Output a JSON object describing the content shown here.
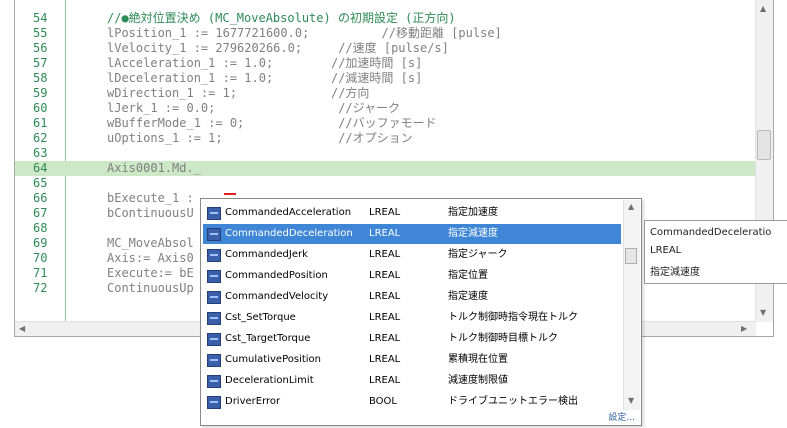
{
  "editor": {
    "lines": [
      {
        "num": "54",
        "code": "//●絶対位置決め (MC_MoveAbsolute) の初期設定 (正方向)",
        "kind": "comment"
      },
      {
        "num": "55",
        "code": "lPosition_1 := 1677721600.0;          //移動距離 [pulse]",
        "kind": "code"
      },
      {
        "num": "56",
        "code": "lVelocity_1 := 279620266.0;     //速度 [pulse/s]",
        "kind": "code"
      },
      {
        "num": "57",
        "code": "lAcceleration_1 := 1.0;        //加速時間 [s]",
        "kind": "code"
      },
      {
        "num": "58",
        "code": "lDeceleration_1 := 1.0;        //減速時間 [s]",
        "kind": "code"
      },
      {
        "num": "59",
        "code": "wDirection_1 := 1;             //方向",
        "kind": "code"
      },
      {
        "num": "60",
        "code": "lJerk_1 := 0.0;                 //ジャーク",
        "kind": "code"
      },
      {
        "num": "61",
        "code": "wBufferMode_1 := 0;             //バッファモード",
        "kind": "code"
      },
      {
        "num": "62",
        "code": "uOptions_1 := 1;                //オプション",
        "kind": "code"
      },
      {
        "num": "63",
        "code": "",
        "kind": "code"
      },
      {
        "num": "64",
        "code": "Axis0001.Md._",
        "kind": "code",
        "highlight": true
      },
      {
        "num": "65",
        "code": "",
        "kind": "code"
      },
      {
        "num": "66",
        "code": "bExecute_1 :",
        "kind": "code"
      },
      {
        "num": "67",
        "code": "bContinuousU",
        "kind": "code"
      },
      {
        "num": "68",
        "code": "",
        "kind": "code"
      },
      {
        "num": "69",
        "code": "MC_MoveAbsol",
        "kind": "code"
      },
      {
        "num": "70",
        "code": "Axis:= Axis0",
        "kind": "code"
      },
      {
        "num": "71",
        "code": "Execute:= bE",
        "kind": "code"
      },
      {
        "num": "72",
        "code": "ContinuousUp",
        "kind": "code"
      }
    ]
  },
  "completion": {
    "items": [
      {
        "name": "CommandedAcceleration",
        "type": "LREAL",
        "desc": "指定加速度",
        "selected": false
      },
      {
        "name": "CommandedDeceleration",
        "type": "LREAL",
        "desc": "指定減速度",
        "selected": true
      },
      {
        "name": "CommandedJerk",
        "type": "LREAL",
        "desc": "指定ジャーク",
        "selected": false
      },
      {
        "name": "CommandedPosition",
        "type": "LREAL",
        "desc": "指定位置",
        "selected": false
      },
      {
        "name": "CommandedVelocity",
        "type": "LREAL",
        "desc": "指定速度",
        "selected": false
      },
      {
        "name": "Cst_SetTorque",
        "type": "LREAL",
        "desc": "トルク制御時指令現在トルク",
        "selected": false
      },
      {
        "name": "Cst_TargetTorque",
        "type": "LREAL",
        "desc": "トルク制御時目標トルク",
        "selected": false
      },
      {
        "name": "CumulativePosition",
        "type": "LREAL",
        "desc": "累積現在位置",
        "selected": false
      },
      {
        "name": "DecelerationLimit",
        "type": "LREAL",
        "desc": "減速度制限値",
        "selected": false
      },
      {
        "name": "DriverError",
        "type": "BOOL",
        "desc": "ドライブユニットエラー検出",
        "selected": false
      }
    ],
    "footer": "設定..."
  },
  "tooltip": {
    "name": "CommandedDeceleratio",
    "type": "LREAL",
    "desc": "指定減速度"
  },
  "icons": {
    "item_icon": "variable-member-icon",
    "scroll_up": "chevron-up-icon",
    "scroll_down": "chevron-down-icon"
  },
  "colors": {
    "line_number": "#2e8b57",
    "comment": "#2e8b57",
    "identifier": "#808080",
    "highlight_row": "#cde8c6",
    "selection": "#3f86d6"
  }
}
